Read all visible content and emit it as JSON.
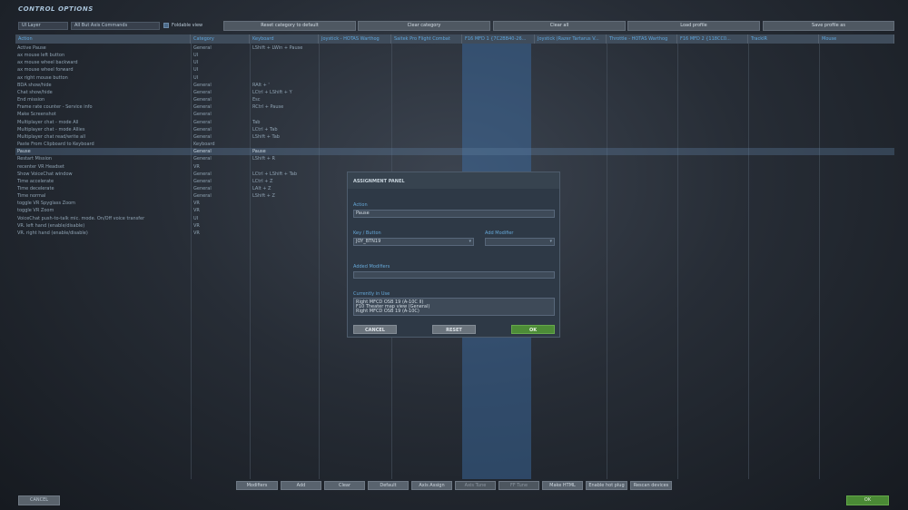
{
  "title": "CONTROL OPTIONS",
  "top_bar": {
    "layer_value": "UI Layer",
    "commands_value": "All But Axis Commands",
    "foldable_label": "Foldable view",
    "buttons": [
      "Reset category to default",
      "Clear category",
      "Clear all",
      "Load profile",
      "Save profile as"
    ]
  },
  "headers": [
    "Action",
    "Category",
    "Keyboard",
    "Joystick - HOTAS Warthog",
    "Saitek Pro Flight Combat",
    "F16 MFD 1 {7C2BB40-26...",
    "Joystick (Razer Tartarus V...",
    "Throttle - HOTAS Warthog",
    "F16 MFD 2 {118CC0...",
    "TrackIR",
    "Mouse"
  ],
  "rows": [
    {
      "action": "Active Pause",
      "category": "General",
      "key": "LShift + LWin + Pause"
    },
    {
      "action": "ax mouse left button",
      "category": "UI",
      "key": ""
    },
    {
      "action": "ax mouse wheel backward",
      "category": "UI",
      "key": ""
    },
    {
      "action": "ax mouse wheel forward",
      "category": "UI",
      "key": ""
    },
    {
      "action": "ax right mouse button",
      "category": "UI",
      "key": ""
    },
    {
      "action": "BDA show/hide",
      "category": "General",
      "key": "RAlt + '"
    },
    {
      "action": "Chat show/hide",
      "category": "General",
      "key": "LCtrl + LShift + Y"
    },
    {
      "action": "End mission",
      "category": "General",
      "key": "Esc"
    },
    {
      "action": "Frame rate counter - Service info",
      "category": "General",
      "key": "RCtrl + Pause"
    },
    {
      "action": "Make Screenshot",
      "category": "General",
      "key": ""
    },
    {
      "action": "Multiplayer chat - mode All",
      "category": "General",
      "key": "Tab"
    },
    {
      "action": "Multiplayer chat - mode Allies",
      "category": "General",
      "key": "LCtrl + Tab"
    },
    {
      "action": "Multiplayer chat read/write all",
      "category": "General",
      "key": "LShift + Tab"
    },
    {
      "action": "Paste From Clipboard to Keyboard",
      "category": "Keyboard",
      "key": ""
    },
    {
      "action": "Pause",
      "category": "General",
      "key": "Pause"
    },
    {
      "action": "Restart Mission",
      "category": "General",
      "key": "LShift + R"
    },
    {
      "action": "recenter VR Headset",
      "category": "VR",
      "key": ""
    },
    {
      "action": "Show VoiceChat window",
      "category": "General",
      "key": "LCtrl + LShift + Tab"
    },
    {
      "action": "Time accelerate",
      "category": "General",
      "key": "LCtrl + Z"
    },
    {
      "action": "Time decelerate",
      "category": "General",
      "key": "LAlt + Z"
    },
    {
      "action": "Time normal",
      "category": "General",
      "key": "LShift + Z"
    },
    {
      "action": "toggle VR Spyglass Zoom",
      "category": "VR",
      "key": ""
    },
    {
      "action": "toggle VR Zoom",
      "category": "VR",
      "key": ""
    },
    {
      "action": "VoiceChat push-to-talk mic. mode. On/Off voice transfer",
      "category": "UI",
      "key": ""
    },
    {
      "action": "VR. left hand (enable/disable)",
      "category": "VR",
      "key": ""
    },
    {
      "action": "VR. right hand (enable/disable)",
      "category": "VR",
      "key": ""
    }
  ],
  "selected_row": 14,
  "panel": {
    "title": "ASSIGNMENT PANEL",
    "action_label": "Action",
    "action_value": "Pause",
    "key_label": "Key / Button",
    "key_value": "JOY_BTN19",
    "modifier_label": "Add Modifier",
    "modifier_value": "",
    "added_label": "Added Modifiers",
    "added_value": "",
    "inuse_label": "Currently in Use",
    "inuse_items": [
      "Right MFCD OSB 19 (A-10C II)",
      "F10 Theater map view (General)",
      "Right MFCD OSB 19 (A-10C)"
    ],
    "cancel": "CANCEL",
    "reset": "RESET",
    "ok": "OK"
  },
  "bottom_buttons": [
    "Modifiers",
    "Add",
    "Clear",
    "Default",
    "Axis Assign",
    "Axis Tune",
    "FF Tune",
    "Make HTML",
    "Enable hot plug",
    "Rescan devices"
  ],
  "bottom_disabled": [
    5,
    6
  ],
  "footer": {
    "cancel": "CANCEL",
    "ok": "OK"
  }
}
